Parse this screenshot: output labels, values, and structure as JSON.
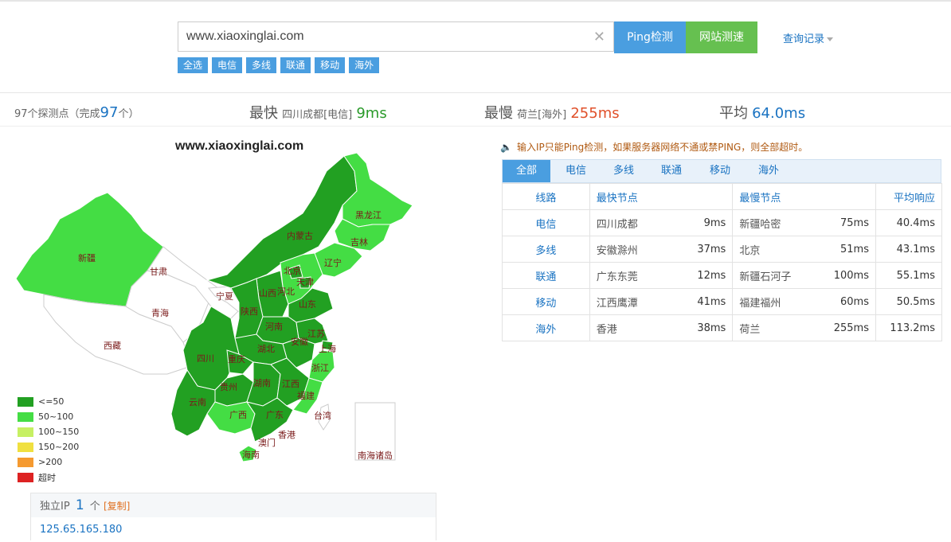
{
  "search": {
    "value": "www.xiaoxinglai.com",
    "clear_icon": "close-icon"
  },
  "buttons": {
    "ping": "Ping检测",
    "speed": "网站测速",
    "history": "查询记录"
  },
  "filters": [
    "全选",
    "电信",
    "多线",
    "联通",
    "移动",
    "海外"
  ],
  "stats": {
    "count_prefix": "97个探测点（完成",
    "done": "97",
    "count_suffix": "个）",
    "fastest_label": "最快",
    "fastest_node": "四川成都[电信]",
    "fastest_ms": "9ms",
    "slowest_label": "最慢",
    "slowest_node": "荷兰[海外]",
    "slowest_ms": "255ms",
    "avg_label": "平均",
    "avg_ms": "64.0ms"
  },
  "map": {
    "title": "www.xiaoxinglai.com",
    "colors": {
      "le50": "#22a022",
      "r50_100": "#44dd44",
      "none": "#ffffff"
    },
    "provinces": [
      "新疆",
      "甘肃",
      "青海",
      "西藏",
      "宁夏",
      "内蒙古",
      "黑龙江",
      "吉林",
      "辽宁",
      "北京",
      "天津",
      "河北",
      "山西",
      "山东",
      "陕西",
      "河南",
      "江苏",
      "安徽",
      "上海",
      "湖北",
      "四川",
      "重庆",
      "浙江",
      "贵州",
      "湖南",
      "江西",
      "福建",
      "云南",
      "广西",
      "广东",
      "台湾",
      "香港",
      "澳门",
      "海南",
      "南海诸岛"
    ]
  },
  "legend": [
    {
      "label": "<=50",
      "color": "#22a022"
    },
    {
      "label": "50~100",
      "color": "#44dd44"
    },
    {
      "label": "100~150",
      "color": "#c6f063"
    },
    {
      "label": "150~200",
      "color": "#f0e040"
    },
    {
      "label": ">200",
      "color": "#f59a30"
    },
    {
      "label": "超时",
      "color": "#dd2222"
    }
  ],
  "notice": "输入IP只能Ping检测，如果服务器网络不通或禁PING，则全部超时。",
  "tabs": [
    "全部",
    "电信",
    "多线",
    "联通",
    "移动",
    "海外"
  ],
  "table": {
    "headers": [
      "线路",
      "最快节点",
      "最慢节点",
      "平均响应"
    ],
    "rows": [
      {
        "line": "电信",
        "fast_node": "四川成都",
        "fast_ms": "9ms",
        "slow_node": "新疆哈密",
        "slow_ms": "75ms",
        "avg": "40.4ms"
      },
      {
        "line": "多线",
        "fast_node": "安徽滁州",
        "fast_ms": "37ms",
        "slow_node": "北京",
        "slow_ms": "51ms",
        "avg": "43.1ms"
      },
      {
        "line": "联通",
        "fast_node": "广东东莞",
        "fast_ms": "12ms",
        "slow_node": "新疆石河子",
        "slow_ms": "100ms",
        "avg": "55.1ms"
      },
      {
        "line": "移动",
        "fast_node": "江西鹰潭",
        "fast_ms": "41ms",
        "slow_node": "福建福州",
        "slow_ms": "60ms",
        "avg": "50.5ms"
      },
      {
        "line": "海外",
        "fast_node": "香港",
        "fast_ms": "38ms",
        "slow_node": "荷兰",
        "slow_ms": "255ms",
        "avg": "113.2ms"
      }
    ]
  },
  "ip": {
    "label": "独立IP",
    "count": "1",
    "unit": "个",
    "copy": "[复制]",
    "addresses": [
      "125.65.165.180"
    ]
  }
}
